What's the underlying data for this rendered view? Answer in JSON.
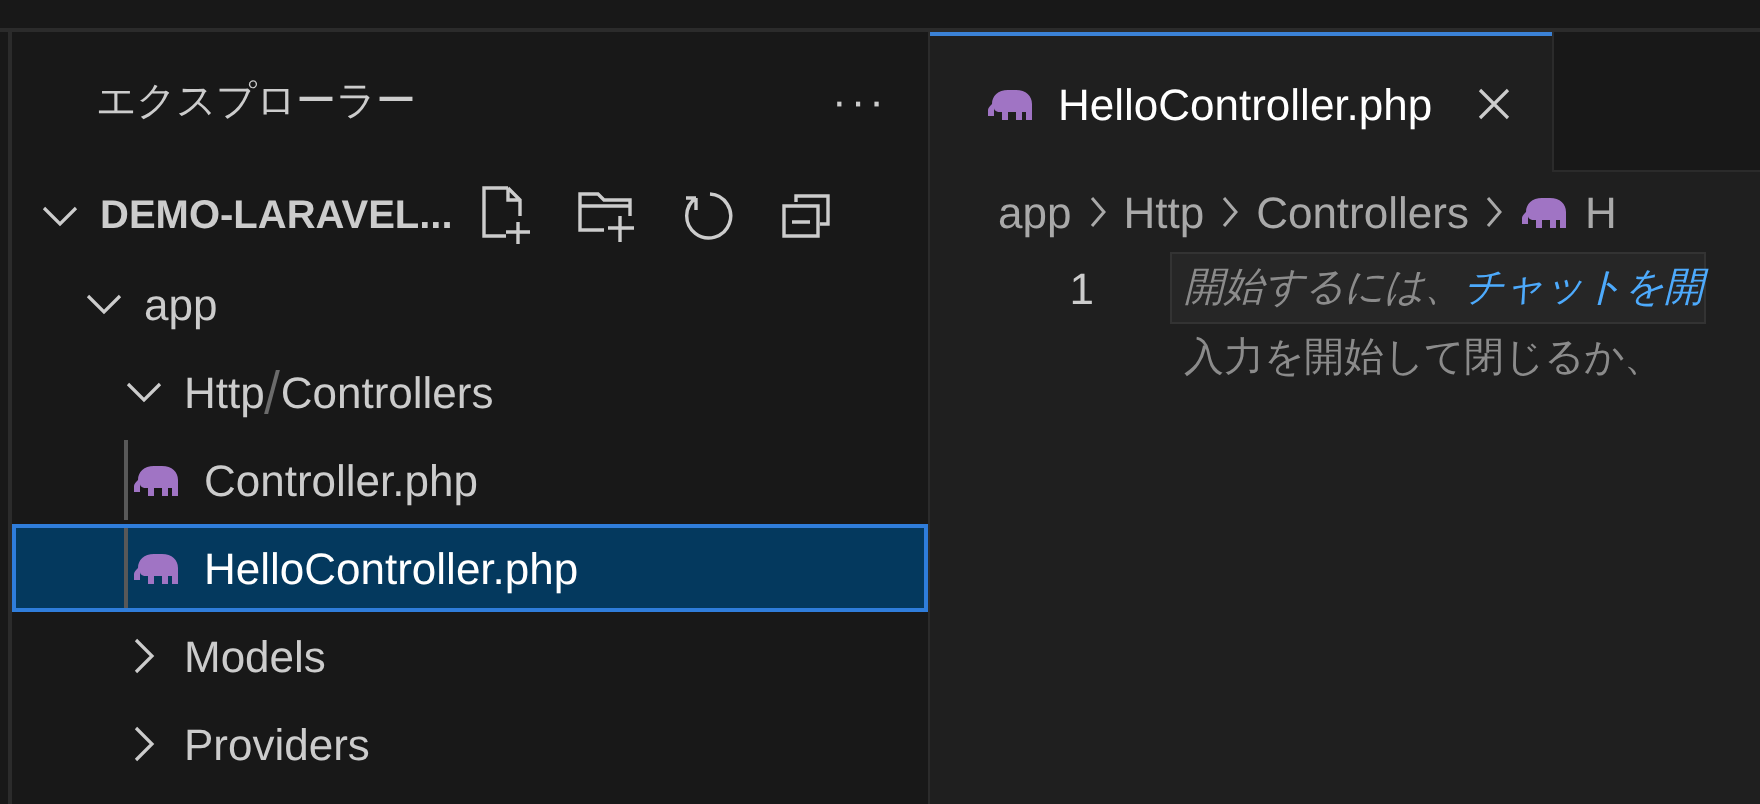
{
  "sidebar": {
    "title": "エクスプローラー",
    "more": "···",
    "tree": [
      {
        "label": "DEMO-LARAVEL...",
        "kind": "root",
        "expanded": true,
        "children": [
          {
            "label": "app",
            "kind": "folder",
            "expanded": true,
            "children": [
              {
                "label": "Http",
                "label2": "Controllers",
                "kind": "compact",
                "expanded": true,
                "children": [
                  {
                    "label": "Controller.php",
                    "kind": "php",
                    "selected": false
                  },
                  {
                    "label": "HelloController.php",
                    "kind": "php",
                    "selected": true
                  }
                ]
              },
              {
                "label": "Models",
                "kind": "folder",
                "expanded": false
              },
              {
                "label": "Providers",
                "kind": "folder",
                "expanded": false
              }
            ]
          }
        ]
      }
    ]
  },
  "tabs": [
    {
      "label": "HelloController.php",
      "selected": true
    }
  ],
  "breadcrumb": [
    {
      "label": "app",
      "kind": "text"
    },
    {
      "label": "Http",
      "kind": "text"
    },
    {
      "label": "Controllers",
      "kind": "text"
    },
    {
      "label": "H",
      "kind": "php"
    }
  ],
  "editor": {
    "line_number": "1",
    "hint_start": "開始するには、",
    "hint_link": "チャットを開",
    "hint_line2": "入力を開始して閉じるか、"
  }
}
